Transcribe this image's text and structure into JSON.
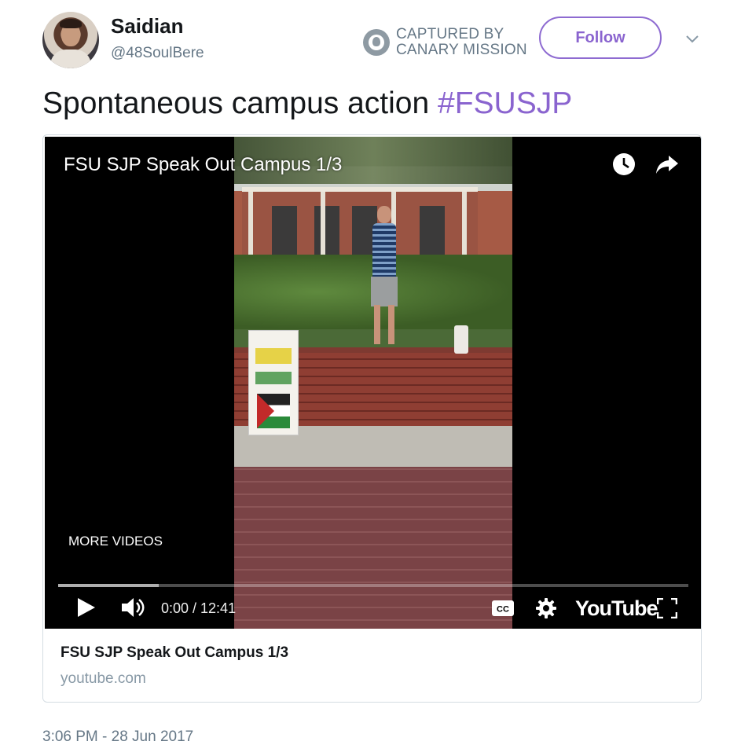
{
  "user": {
    "name": "Saidian",
    "handle": "@48SoulBere"
  },
  "badge": {
    "line1": "CAPTURED BY",
    "line2": "CANARY MISSION"
  },
  "follow_label": "Follow",
  "tweet": {
    "text": "Spontaneous campus action ",
    "hashtag": "#FSUSJP"
  },
  "video": {
    "title": "FSU SJP Speak Out Campus 1/3",
    "more_videos": "MORE VIDEOS",
    "time": "0:00 / 12:41",
    "logo": "YouTube",
    "progress_buffered": 0.16
  },
  "card": {
    "title": "FSU SJP Speak Out Campus 1/3",
    "domain": "youtube.com"
  },
  "timestamp": "3:06 PM - 28 Jun 2017",
  "colors": {
    "accent": "#8a64cf",
    "muted": "#657786"
  },
  "icons": [
    "watch-later-icon",
    "share-icon",
    "play-icon",
    "volume-icon",
    "captions-icon",
    "gear-icon",
    "fullscreen-icon",
    "chevron-down-icon",
    "canary-icon"
  ]
}
